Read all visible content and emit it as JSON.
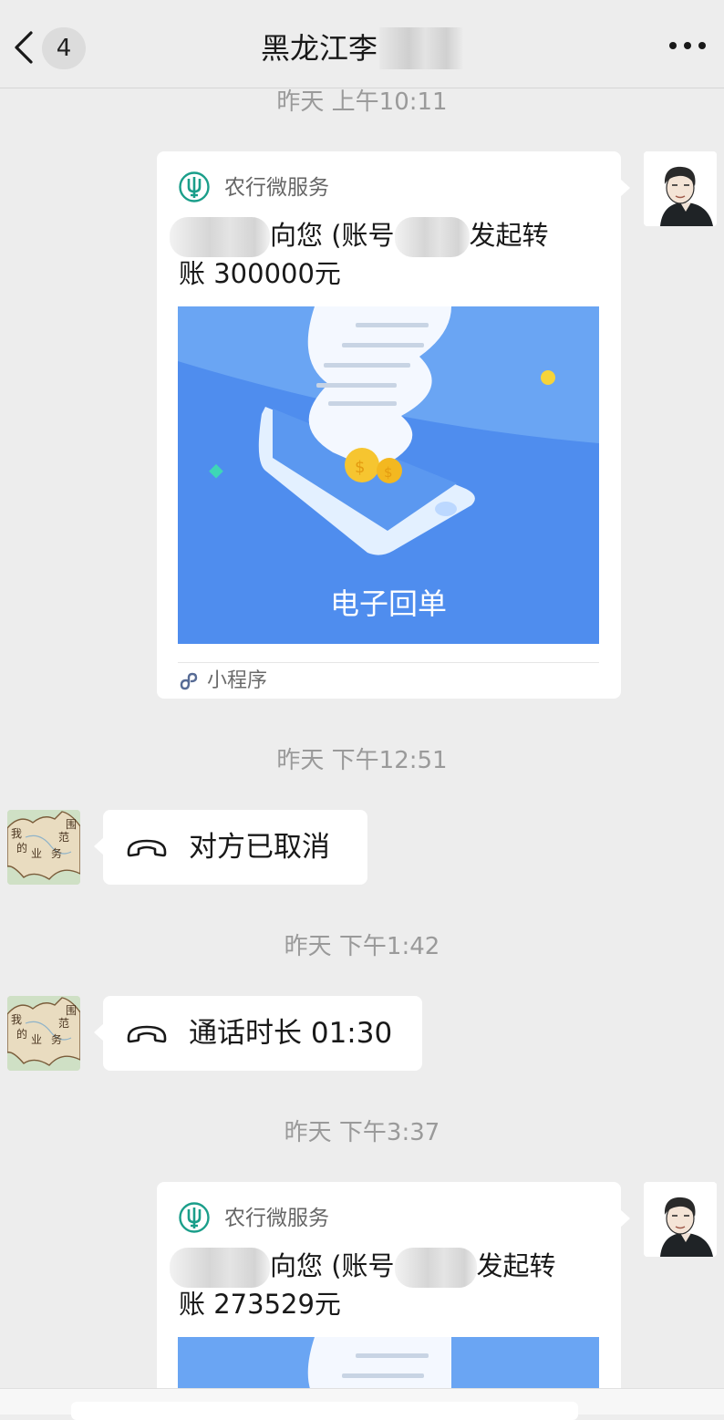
{
  "header": {
    "unread_count": "4",
    "title": "黑龙江李"
  },
  "messages": [
    {
      "type": "time",
      "text": "昨天 上午10:11"
    },
    {
      "type": "card",
      "app": "农行微服务",
      "text_mid": "向您 (账号",
      "text_end": "发起转",
      "text_line2": "账 300000元",
      "image_caption": "电子回单",
      "footer": "小程序"
    },
    {
      "type": "time",
      "text": "昨天 下午12:51"
    },
    {
      "type": "call",
      "text": "对方已取消"
    },
    {
      "type": "time",
      "text": "昨天 下午1:42"
    },
    {
      "type": "call",
      "text": "通话时长 01:30"
    },
    {
      "type": "time",
      "text": "昨天 下午3:37"
    },
    {
      "type": "card",
      "app": "农行微服务",
      "text_mid": "向您 (账号",
      "text_end": "发起转",
      "text_line2": "账 273529元"
    }
  ],
  "peer_avatar_text": [
    "我",
    "的",
    "业",
    "务",
    "范",
    "围"
  ],
  "colors": {
    "background": "#ededed",
    "bubble": "#ffffff",
    "receipt_blue": "#4f8dee",
    "abc_green": "#1a9e8a",
    "mini_program_blue": "#576b95"
  }
}
